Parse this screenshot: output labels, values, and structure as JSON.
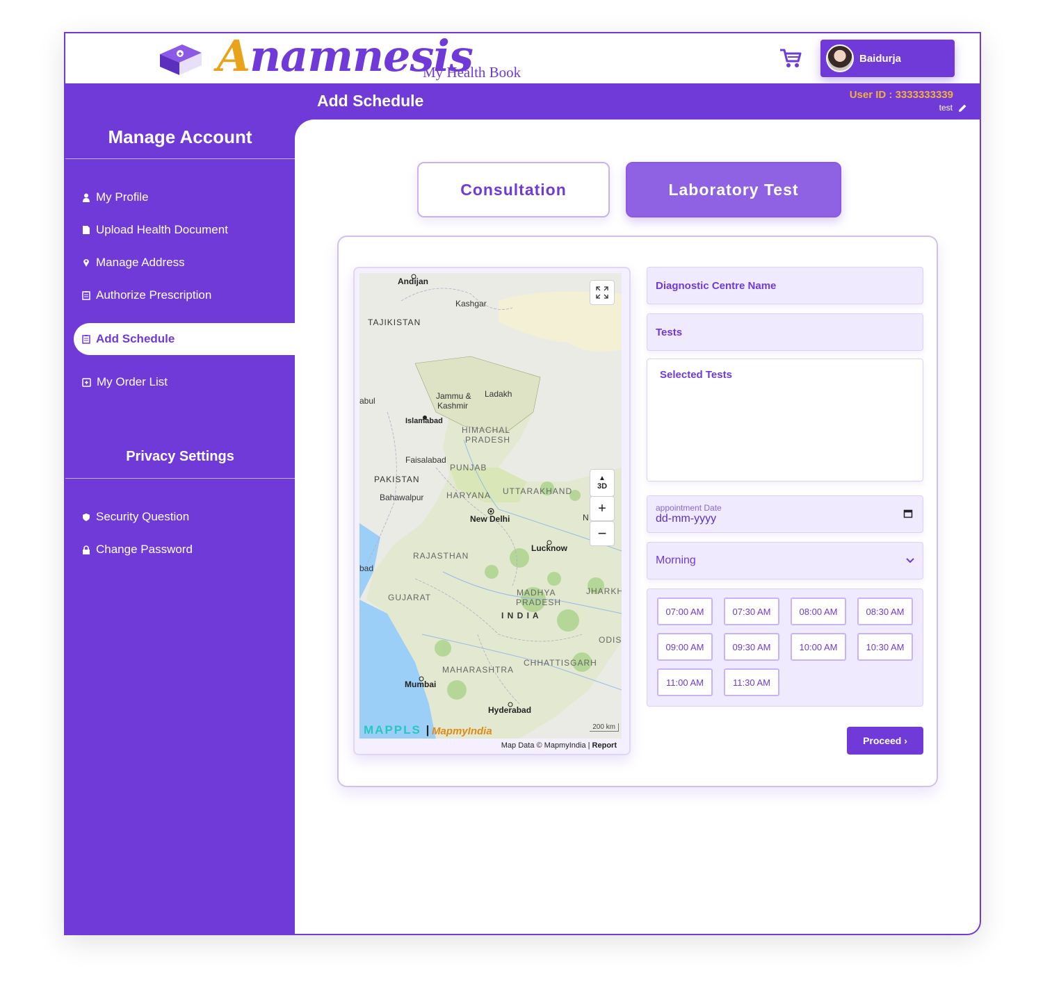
{
  "header": {
    "logo_text_first": "A",
    "logo_text_rest": "namnesis",
    "logo_subtitle": "My Health Book",
    "user_name": "Baidurja",
    "page_title": "Add Schedule",
    "user_id": "User ID : 3333333339",
    "user_sub": "test"
  },
  "sidebar": {
    "manage_title": "Manage Account",
    "items": [
      {
        "label": "My Profile",
        "icon": "user-icon"
      },
      {
        "label": "Upload Health Document",
        "icon": "document-icon"
      },
      {
        "label": "Manage Address",
        "icon": "location-pin-icon"
      },
      {
        "label": "Authorize Prescription",
        "icon": "clipboard-icon"
      },
      {
        "label": "Add Schedule",
        "icon": "clipboard-icon",
        "active": true
      },
      {
        "label": "My Order List",
        "icon": "order-list-icon"
      }
    ],
    "privacy_title": "Privacy Settings",
    "privacy_items": [
      {
        "label": "Security Question",
        "icon": "shield-icon"
      },
      {
        "label": "Change Password",
        "icon": "lock-icon"
      }
    ]
  },
  "tabs": {
    "consultation": "Consultation",
    "laboratory": "Laboratory Test"
  },
  "map": {
    "labels": {
      "andijan": "Andijan",
      "kashgar": "Kashgar",
      "tajikistan": "TAJIKISTAN",
      "jammu1": "Jammu &",
      "jammu2": "Kashmir",
      "ladakh": "Ladakh",
      "kabul": "abul",
      "islamabad": "Islamabad",
      "himachal1": "HIMACHAL",
      "himachal2": "PRADESH",
      "faisalabad": "Faisalabad",
      "punjab": "PUNJAB",
      "pakistan": "PAKISTAN",
      "bahawalpur": "Bahawalpur",
      "haryana": "HARYANA",
      "uttarakhand": "UTTARAKHAND",
      "newdelhi": "New Delhi",
      "lucknow": "Lucknow",
      "rajasthan": "RAJASTHAN",
      "bad": "bad",
      "gujarat": "GUJARAT",
      "madhya1": "MADHYA",
      "madhya2": "PRADESH",
      "jharkhand": "JHARKH",
      "india": "I N D I A",
      "odisha": "ODIS",
      "chhattisgarh": "CHHATTISGARH",
      "maharashtra": "MAHARASHTRA",
      "mumbai": "Mumbai",
      "hyderabad": "Hyderabad",
      "nepal_n": "N"
    },
    "btn_3d": "3D",
    "zoom_in": "+",
    "zoom_out": "−",
    "brand1": "MAPPLS",
    "brand2": "MapmyIndia",
    "scale": "200 km",
    "credit": "Map Data © MapmyIndia | ",
    "report": "Report"
  },
  "form": {
    "centre_placeholder": "Diagnostic Centre Name",
    "tests_placeholder": "Tests",
    "selected_tests_label": "Selected Tests",
    "date_label": "appointment Date",
    "date_value": "dd-mm-yyyy",
    "session_value": "Morning",
    "slots": [
      "07:00 AM",
      "07:30 AM",
      "08:00 AM",
      "08:30 AM",
      "09:00 AM",
      "09:30 AM",
      "10:00 AM",
      "10:30 AM",
      "11:00 AM",
      "11:30 AM"
    ],
    "proceed": "Proceed ›"
  },
  "colors": {
    "primary": "#6f3ad8",
    "accent_yellow": "#e8a31b",
    "light_purple": "#f0eafe"
  }
}
